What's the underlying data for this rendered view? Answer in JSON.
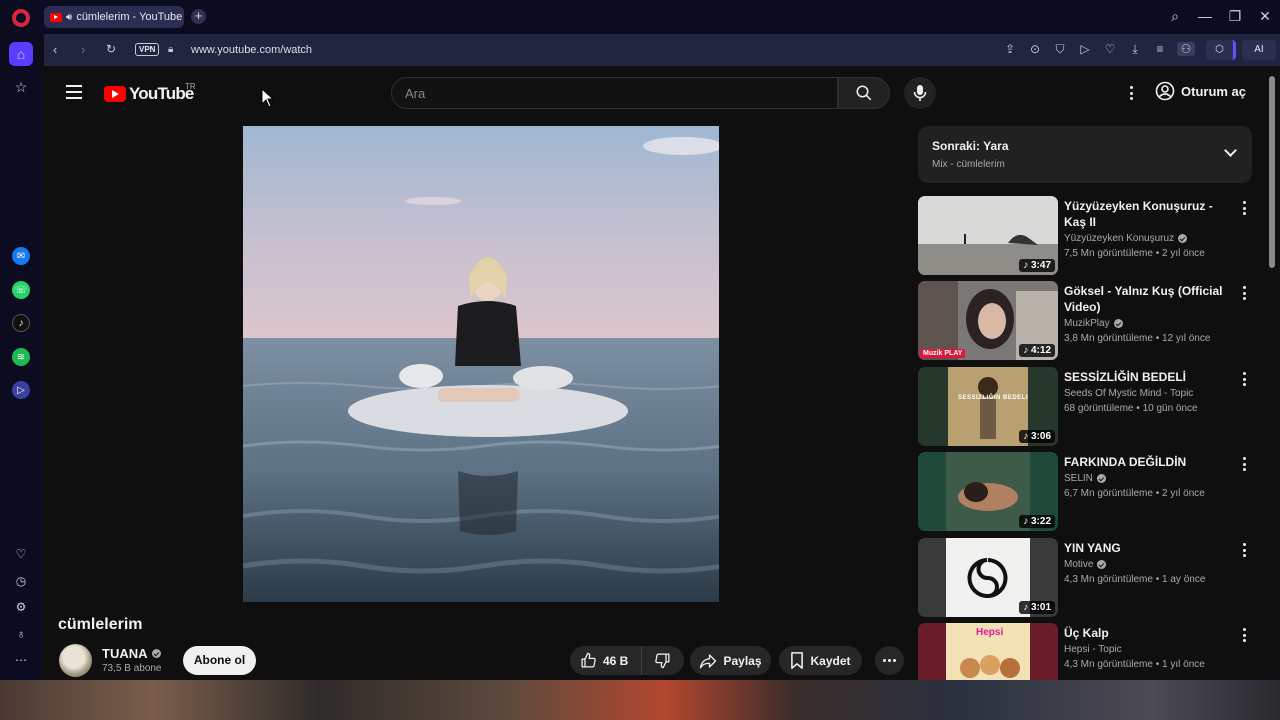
{
  "browser": {
    "tab_title": "cümlelerim - YouTube",
    "new_tab": "+",
    "url": "www.youtube.com/watch",
    "vpn_label": "VPN",
    "ai_label": "AI",
    "window_controls": {
      "search": "⌕",
      "minimize": "—",
      "restore": "❐",
      "close": "✕"
    }
  },
  "youtube": {
    "logo_text": "YouTube",
    "logo_region": "TR",
    "search_placeholder": "Ara",
    "sign_in": "Oturum aç"
  },
  "video": {
    "title": "cümlelerim",
    "channel": "TUANA",
    "subscribers": "73,5 B abone",
    "subscribe_label": "Abone ol",
    "likes": "46 B",
    "share_label": "Paylaş",
    "save_label": "Kaydet"
  },
  "up_next": {
    "title": "Sonraki: Yara",
    "subtitle": "Mix - cümlelerim"
  },
  "recommendations": [
    {
      "title": "Yüzyüzeyken Konuşuruz - Kaş II",
      "channel": "Yüzyüzeyken Konuşuruz",
      "verified": true,
      "views": "7,5 Mn görüntüleme",
      "age": "2 yıl önce",
      "duration": "3:47"
    },
    {
      "title": "Göksel - Yalnız Kuş (Official Video)",
      "channel": "MuzikPlay",
      "verified": true,
      "views": "3,8 Mn görüntüleme",
      "age": "12 yıl önce",
      "duration": "4:12",
      "thumb_badge": "Muzik PLAY"
    },
    {
      "title": "SESSİZLİĞİN BEDELİ",
      "channel": "Seeds Of Mystic Mind - Topic",
      "verified": false,
      "views": "68 görüntüleme",
      "age": "10 gün önce",
      "duration": "3:06",
      "thumb_text": "SESSIZLIĞIN BEDELI"
    },
    {
      "title": "FARKINDA DEĞİLDİN",
      "channel": "SELIN",
      "verified": true,
      "views": "6,7 Mn görüntüleme",
      "age": "2 yıl önce",
      "duration": "3:22"
    },
    {
      "title": "YIN YANG",
      "channel": "Motive",
      "verified": true,
      "views": "4,3 Mn görüntüleme",
      "age": "1 ay önce",
      "duration": "3:01"
    },
    {
      "title": "Üç Kalp",
      "channel": "Hepsi - Topic",
      "verified": false,
      "views": "4,3 Mn görüntüleme",
      "age": "1 yıl önce",
      "duration": "",
      "thumb_text": "Hepsi"
    }
  ],
  "colors": {
    "accent": "#ff0000",
    "background": "#0f0f0f",
    "browser_accent": "#5a3dff"
  }
}
